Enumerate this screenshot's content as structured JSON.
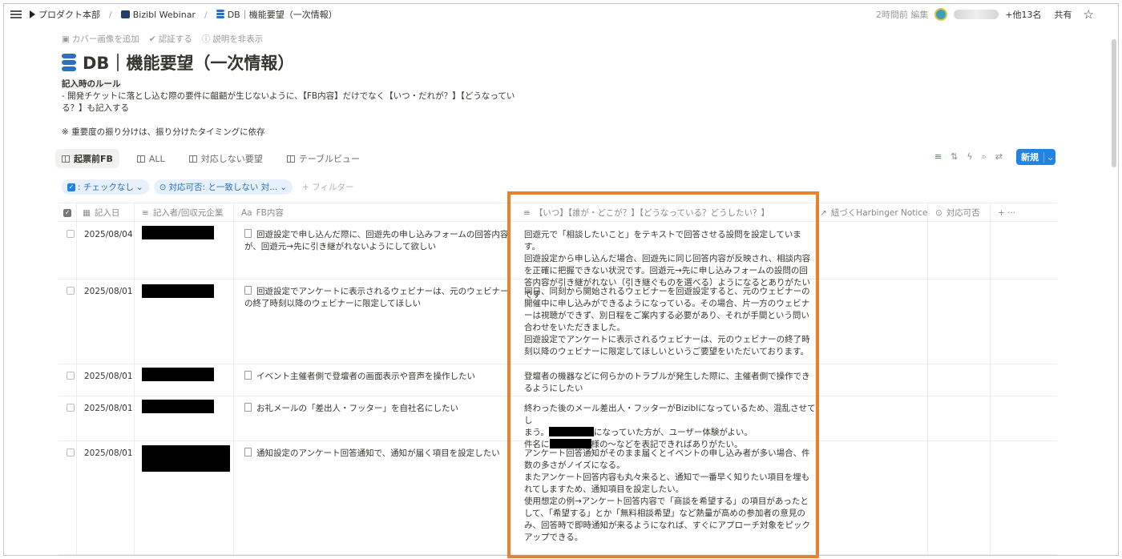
{
  "breadcrumbs": [
    "プロダクト本部",
    "Bizibl Webinar",
    "DB｜機能要望（一次情報）"
  ],
  "topbar": {
    "edited": "2時間前 編集",
    "others": "+他13名",
    "share": "共有"
  },
  "page_actions": [
    "カバー画像を追加",
    "認証する",
    "説明を非表示"
  ],
  "title": "DB｜機能要望（一次情報）",
  "description": {
    "rule_heading": "記入時のルール",
    "line1": "- 開発チケットに落とし込む際の要件に齟齬が生じないように、【FB内容】だけでなく【いつ・だれが？】【どうなってい",
    "line2": "る？】も記入する",
    "note": "※ 重要度の振り分けは、振り分けたタイミングに依存"
  },
  "views": [
    "起票前FB",
    "ALL",
    "対応しない要望",
    "テーブルビュー"
  ],
  "new_button": "新規",
  "filters": {
    "chip1": ": チェックなし",
    "chip2": "対応可否: と一致しない 対...",
    "add": "+ フィルター"
  },
  "columns": {
    "date": "記入日",
    "person": "記入者/回収元企業",
    "fb": "FB内容",
    "context": "【いつ】【誰が・どこが？】【どうなっている？どうしたい？】",
    "harbinger": "紐づくHarbinger Notice",
    "feasibility": "対応可否",
    "more": "+ ···"
  },
  "rows": [
    {
      "date": "2025/08/04",
      "fb": "回遊設定で申し込んだ際に、回遊先の申し込みフォームの回答内容が、回遊元→先に引き継がれないようにして欲しい",
      "context": "回遊元で「相談したいこと」をテキストで回答させる設問を設定しています。\n回遊設定から申し込んだ場合、回遊先に同じ回答内容が反映され、相談内容を正確に把握できない状況です。回遊元→先に申し込みフォームの設問の回答内容が引き継がれない（引き継ぐものを選べる）ようになるとありがたいです"
    },
    {
      "date": "2025/08/01",
      "fb": "回遊設定でアンケートに表示されるウェビナーは、元のウェビナーの終了時刻以降のウェビナーに限定してほしい",
      "context": "同日、同刻から開始されるウェビナーを回遊設定すると、元のウェビナーの開催中に申し込みができるようになっている。その場合、片一方のウェビナーは視聴ができず、別日程をご案内する必要があり、それが手間という問い合わせをいただきました。\n回遊設定でアンケートに表示されるウェビナーは、元のウェビナーの終了時刻以降のウェビナーに限定してほしいというご要望をいただいております。"
    },
    {
      "date": "2025/08/01",
      "fb": "イベント主催者側で登壇者の画面表示や音声を操作したい",
      "context": "登壇者の機器などに何らかのトラブルが発生した際に、主催者側で操作できるようにしたい"
    },
    {
      "date": "2025/08/01",
      "fb": "お礼メールの「差出人・フッター」を自社名にしたい",
      "context_l1": "終わった後のメール差出人・フッターがBiziblになっているため、混乱させてし",
      "context_l2a": "まう。",
      "context_l2b": "になっていた方が、ユーザー体験がよい。",
      "context_l3a": "件名に",
      "context_l3b": "様の〜などを表記できればありがたい。"
    },
    {
      "date": "2025/08/01",
      "fb": "通知設定のアンケート回答通知で、通知が届く項目を設定したい",
      "context": "アンケート回答通知がそのまま届くとイベントの申し込み者が多い場合、件数の多さがノイズになる。\nまたアンケート回答内容も丸々来ると、通知で一番早く知りたい項目を埋もれてしますため、通知項目を設定したい。\n使用想定の例→アンケート回答内容で「商談を希望する」の項目があったとして、「希望する」とか「無料相談希望」など熱量が高めの参加者の意見のみ、回答時で即時通知が来るようになれば、すぐにアプローチ対象をピックアップできる。"
    }
  ]
}
